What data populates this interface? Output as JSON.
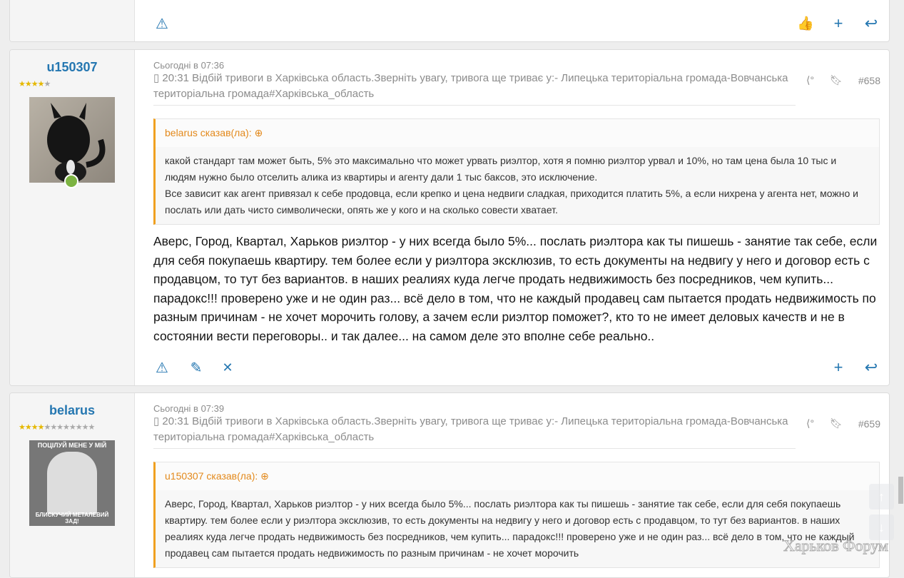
{
  "top_post": {
    "actions": [
      "report",
      "like",
      "multiquote",
      "reply"
    ]
  },
  "posts": [
    {
      "author": "u150307",
      "stars_on": 4,
      "stars_total": 5,
      "date": "Сьогодні в 07:36",
      "signature": "▯ 20:31 Відбій тривоги в Харківська область.Зверніть увагу, тривога ще триває у:- Липецька територіальна громада-Вовчанська територіальна громада#Харківська_область",
      "number": "#658",
      "quote": {
        "header": "belarus сказав(ла):",
        "text": "какой стандарт там может быть, 5% это максимально что может урвать риэлтор, хотя я помню риэлтор урвал и 10%, но там цена была 10 тыс и людям нужно было отселить алика из квартиры и агенту дали 1 тыс баксов, это исключение.\nВсе зависит как агент привязал к себе продовца, если крепко и цена недвиги сладкая, приходится платить 5%, а если нихрена у агента нет, можно и послать или дать чисто символически, опять же у кого и на сколько совести хватает."
      },
      "text": "Аверс, Город, Квартал, Харьков риэлтор - у них всегда было 5%... послать риэлтора как ты пишешь - занятие так себе, если для себя покупаешь квартиру. тем более если у риэлтора эксклюзив, то есть документы на недвигу у него и договор есть с продавцом, то тут без вариантов. в наших реалиях куда легче продать недвижимость без посредников, чем купить... парадокс!!! проверено уже и не один раз... всё дело в том, что не каждый продавец сам пытается продать недвижимость по разным причинам - не хочет морочить голову, а зачем если риэлтор поможет?, кто то не имеет деловых качеств и не в состоянии вести переговоры.. и так далее... на самом деле это вполне себе реально.."
    },
    {
      "author": "belarus",
      "stars_on": 4,
      "stars_total": 12,
      "date": "Сьогодні в 07:39",
      "signature": "▯ 20:31 Відбій тривоги в Харківська область.Зверніть увагу, тривога ще триває у:- Липецька територіальна громада-Вовчанська територіальна громада#Харківська_область",
      "number": "#659",
      "avatar_top": "ПОЦІЛУЙ МЕНЕ У МІЙ",
      "avatar_bottom": "БЛИСКУЧИЙ МЕТАЛЕВИЙ ЗАД!",
      "quote": {
        "header": "u150307 сказав(ла):",
        "text": "Аверс, Город, Квартал, Харьков риэлтор - у них всегда было 5%... послать риэлтора как ты пишешь - занятие так себе, если для себя покупаешь квартиру. тем более если у риэлтора эксклюзив, то есть документы на недвигу у него и договор есть с продавцом, то тут без вариантов. в наших реалиях куда легче продать недвижимость без посредников, чем купить... парадокс!!! проверено уже и не один раз... всё дело в том, что не каждый продавец сам пытается продать недвижимость по разным причинам - не хочет морочить"
      }
    }
  ],
  "watermark": "Харьков Форум"
}
